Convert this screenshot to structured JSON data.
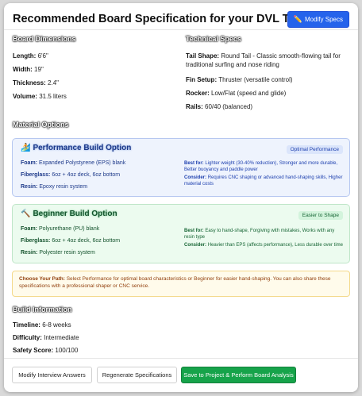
{
  "header": {
    "title": "Recommended Board Specification for your DVL TEST",
    "modify_specs_label": "Modify Specs",
    "modify_specs_icon": "pencil-icon"
  },
  "board_dimensions": {
    "heading": "Board Dimensions",
    "length_label": "Length:",
    "length_value": "6'6\"",
    "width_label": "Width:",
    "width_value": "19\"",
    "thickness_label": "Thickness:",
    "thickness_value": "2.4\"",
    "volume_label": "Volume:",
    "volume_value": "31.5 liters"
  },
  "technical_specs": {
    "heading": "Technical Specs",
    "tail_label": "Tail Shape:",
    "tail_value_1": "Round Tail - Classic smooth-flowing tail for",
    "tail_value_2": "traditional surfing and nose riding",
    "fin_label": "Fin Setup:",
    "fin_value": "Thruster (versatile control)",
    "rocker_label": "Rocker:",
    "rocker_value": "Low/Flat (speed and glide)",
    "rails_label": "Rails:",
    "rails_value": "60/40 (balanced)"
  },
  "material_options": {
    "heading": "Material Options",
    "performance": {
      "icon": "surfer-icon",
      "title": "Performance Build Option",
      "badge": "Optimal Performance",
      "foam_label": "Foam:",
      "foam_value": "Expanded Polystyrene (EPS) blank",
      "fiberglass_label": "Fiberglass:",
      "fiberglass_value": "6oz + 4oz deck, 6oz bottom",
      "resin_label": "Resin:",
      "resin_value": "Epoxy resin system",
      "best_for_label": "Best for:",
      "best_for_value": "Lighter weight (30-40% reduction), Stronger and more durable, Better buoyancy and paddle power",
      "consider_label": "Consider:",
      "consider_value": "Requires CNC shaping or advanced hand-shaping skills, Higher material costs"
    },
    "beginner": {
      "icon": "hammer-icon",
      "title": "Beginner Build Option",
      "badge": "Easier to Shape",
      "foam_label": "Foam:",
      "foam_value": "Polyurethane (PU) blank",
      "fiberglass_label": "Fiberglass:",
      "fiberglass_value": "6oz + 4oz deck, 6oz bottom",
      "resin_label": "Resin:",
      "resin_value": "Polyester resin system",
      "best_for_label": "Best for:",
      "best_for_value": "Easy to hand-shape, Forgiving with mistakes, Works with any resin type",
      "consider_label": "Consider:",
      "consider_value": "Heavier than EPS (affects performance), Less durable over time"
    },
    "choose_label": "Choose Your Path:",
    "choose_text": "Select Performance for optimal board characteristics or Beginner for easier hand-shaping. You can also share these specifications with a professional shaper or CNC service."
  },
  "build_information": {
    "heading": "Build Information",
    "timeline_label": "Timeline:",
    "timeline_value": "6-8 weeks",
    "difficulty_label": "Difficulty:",
    "difficulty_value": "Intermediate",
    "safety_label": "Safety Score:",
    "safety_value": "100/100"
  },
  "footer": {
    "modify_answers_label": "Modify Interview Answers",
    "regenerate_label": "Regenerate Specifications",
    "save_label": "Save to Project & Perform Board Analysis"
  },
  "colors": {
    "primary_button": "#2563eb",
    "save_button": "#16a34a",
    "performance_bg": "#eef3fd",
    "beginner_bg": "#ecfbef",
    "note_bg": "#fffbeb"
  }
}
